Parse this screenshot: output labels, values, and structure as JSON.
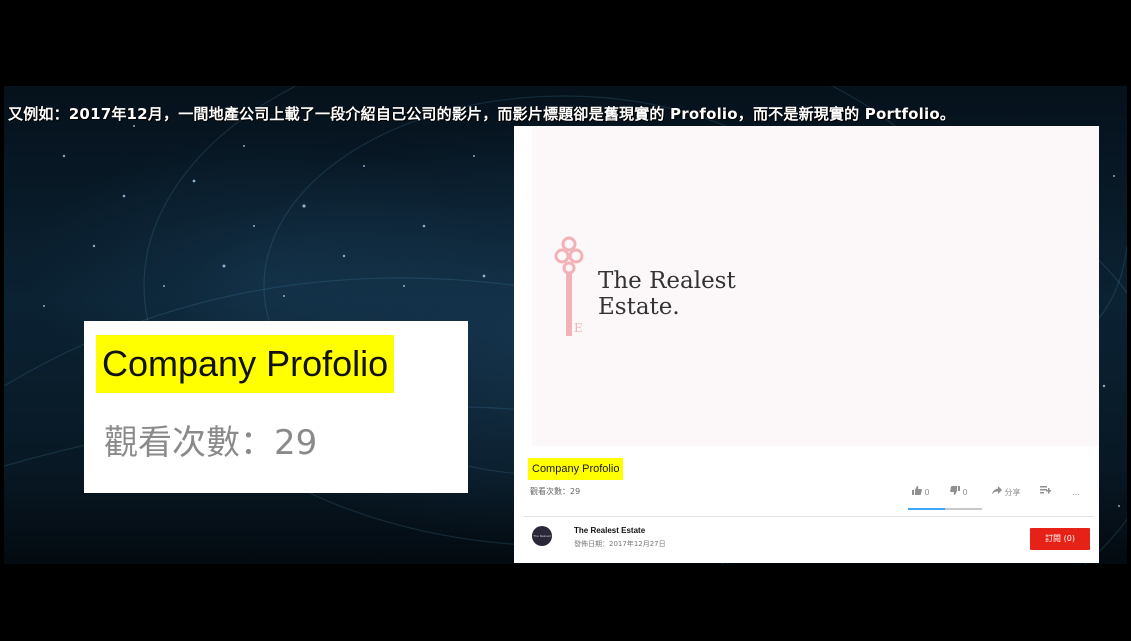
{
  "caption": "又例如：2017年12月，一間地產公司上載了一段介紹自己公司的影片，而影片標題卻是舊現實的 Profolio，而不是新現實的 Portfolio。",
  "callout": {
    "title": "Company Profolio",
    "views": "觀看次數：29"
  },
  "video_page": {
    "logo_text_line1": "The Realest",
    "logo_text_line2": "Estate.",
    "logo_key_letter": "E",
    "title": "Company Profolio",
    "views": "觀看次數：29",
    "likes": "0",
    "dislikes": "0",
    "share_label": "分享",
    "more_label": "…",
    "like_ratio": 0.5,
    "channel_name": "The Realest Estate",
    "publish_date": "發佈日期：2017年12月27日",
    "subscribe_label": "訂閱 (0)",
    "avatar_text": "The Realest Estate"
  },
  "colors": {
    "highlight": "#ffff00",
    "subscribe": "#e62117",
    "logo_pink": "#f2b3b8"
  },
  "icons": [
    "thumbs-up-icon",
    "thumbs-down-icon",
    "share-icon",
    "add-to-playlist-icon",
    "more-icon",
    "key-icon"
  ]
}
